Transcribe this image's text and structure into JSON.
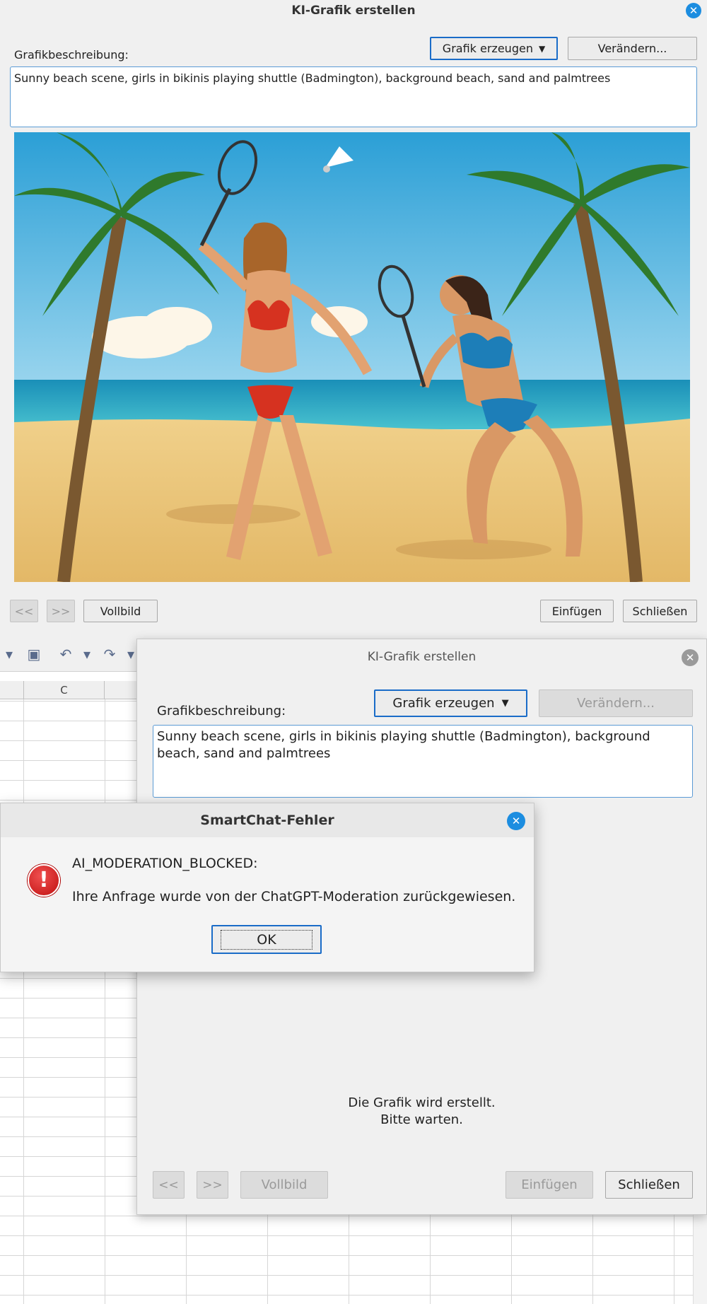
{
  "dialog1": {
    "title": "KI-Grafik erstellen",
    "label_description": "Grafikbeschreibung:",
    "btn_generate": "Grafik erzeugen",
    "btn_modify": "Verändern...",
    "description_text": "Sunny beach scene, girls in bikinis playing shuttle (Badmington), background beach, sand and palmtrees",
    "btn_prev": "<<",
    "btn_next": ">>",
    "btn_fullscreen": "Vollbild",
    "btn_insert": "Einfügen",
    "btn_close": "Schließen"
  },
  "sheet": {
    "column_c": "C"
  },
  "dialog2": {
    "title": "KI-Grafik erstellen",
    "label_description": "Grafikbeschreibung:",
    "btn_generate": "Grafik erzeugen",
    "btn_modify": "Verändern...",
    "description_text": "Sunny beach scene, girls in bikinis playing shuttle (Badmington), background beach, sand and palmtrees",
    "status_line1": "Die Grafik wird erstellt.",
    "status_line2": "Bitte warten.",
    "btn_prev": "<<",
    "btn_next": ">>",
    "btn_fullscreen": "Vollbild",
    "btn_insert": "Einfügen",
    "btn_close": "Schließen"
  },
  "error_dialog": {
    "title": "SmartChat-Fehler",
    "code": "AI_MODERATION_BLOCKED:",
    "message": "Ihre Anfrage wurde von der ChatGPT-Moderation zurückgewiesen.",
    "btn_ok": "OK"
  },
  "colors": {
    "accent": "#1a6cc8",
    "close_blue": "#1c8de0",
    "error_red": "#d01818"
  }
}
